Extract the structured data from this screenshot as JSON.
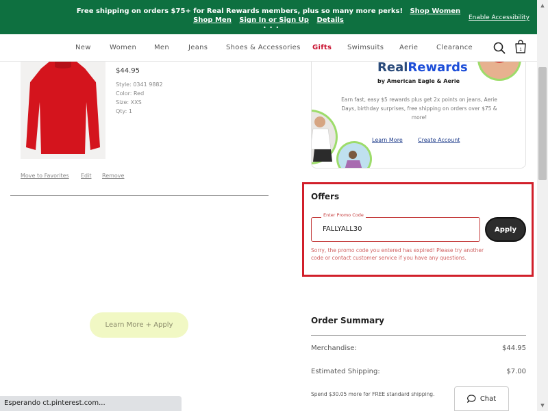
{
  "banner": {
    "promo_text": "Free shipping on orders $75+ for Real Rewards members, plus so many more perks!",
    "shop_women": "Shop Women",
    "shop_men": "Shop Men",
    "sign_in": "Sign In or Sign Up",
    "details": "Details",
    "dots": "• • •",
    "accessibility": "Enable Accessibility",
    "bg_color": "#0e7040"
  },
  "nav": {
    "items": [
      "New",
      "Women",
      "Men",
      "Jeans",
      "Shoes & Accessories",
      "Gifts",
      "Swimsuits",
      "Aerie",
      "Clearance"
    ],
    "bag_count": "1",
    "icons": [
      "search-icon",
      "bag-icon"
    ]
  },
  "cart_item": {
    "price": "$44.95",
    "style": "Style: 0341 9882",
    "color": "Color: Red",
    "size": "Size: XXS",
    "qty": "Qty: 1",
    "move_to_favorites": "Move to Favorites",
    "edit": "Edit",
    "remove": "Remove"
  },
  "learn_more_apply": "Learn More + Apply",
  "real_rewards": {
    "title_part1": "Real",
    "title_part2": "Rewards",
    "subtitle": "by American Eagle & Aerie",
    "description": "Earn fast, easy $5 rewards plus get 2x points on jeans, Aerie Days, birthday surprises, free shipping on orders over $75 & more!",
    "learn_more": "Learn More",
    "create_account": "Create Account"
  },
  "offers": {
    "title": "Offers",
    "promo_label": "Enter Promo Code",
    "promo_value": "FALLYALL30",
    "apply": "Apply",
    "error": "Sorry, the promo code you entered has expired! Please try another code or contact customer service if you have any questions.",
    "highlight_color": "#d11f2a"
  },
  "order_summary": {
    "title": "Order Summary",
    "merchandise_label": "Merchandise:",
    "merchandise_value": "$44.95",
    "shipping_label": "Estimated Shipping:",
    "shipping_value": "$7.00",
    "note": "Spend $30.05 more for FREE standard shipping."
  },
  "chat": {
    "label": "Chat"
  },
  "status_bar": {
    "text": "Esperando ct.pinterest.com..."
  }
}
